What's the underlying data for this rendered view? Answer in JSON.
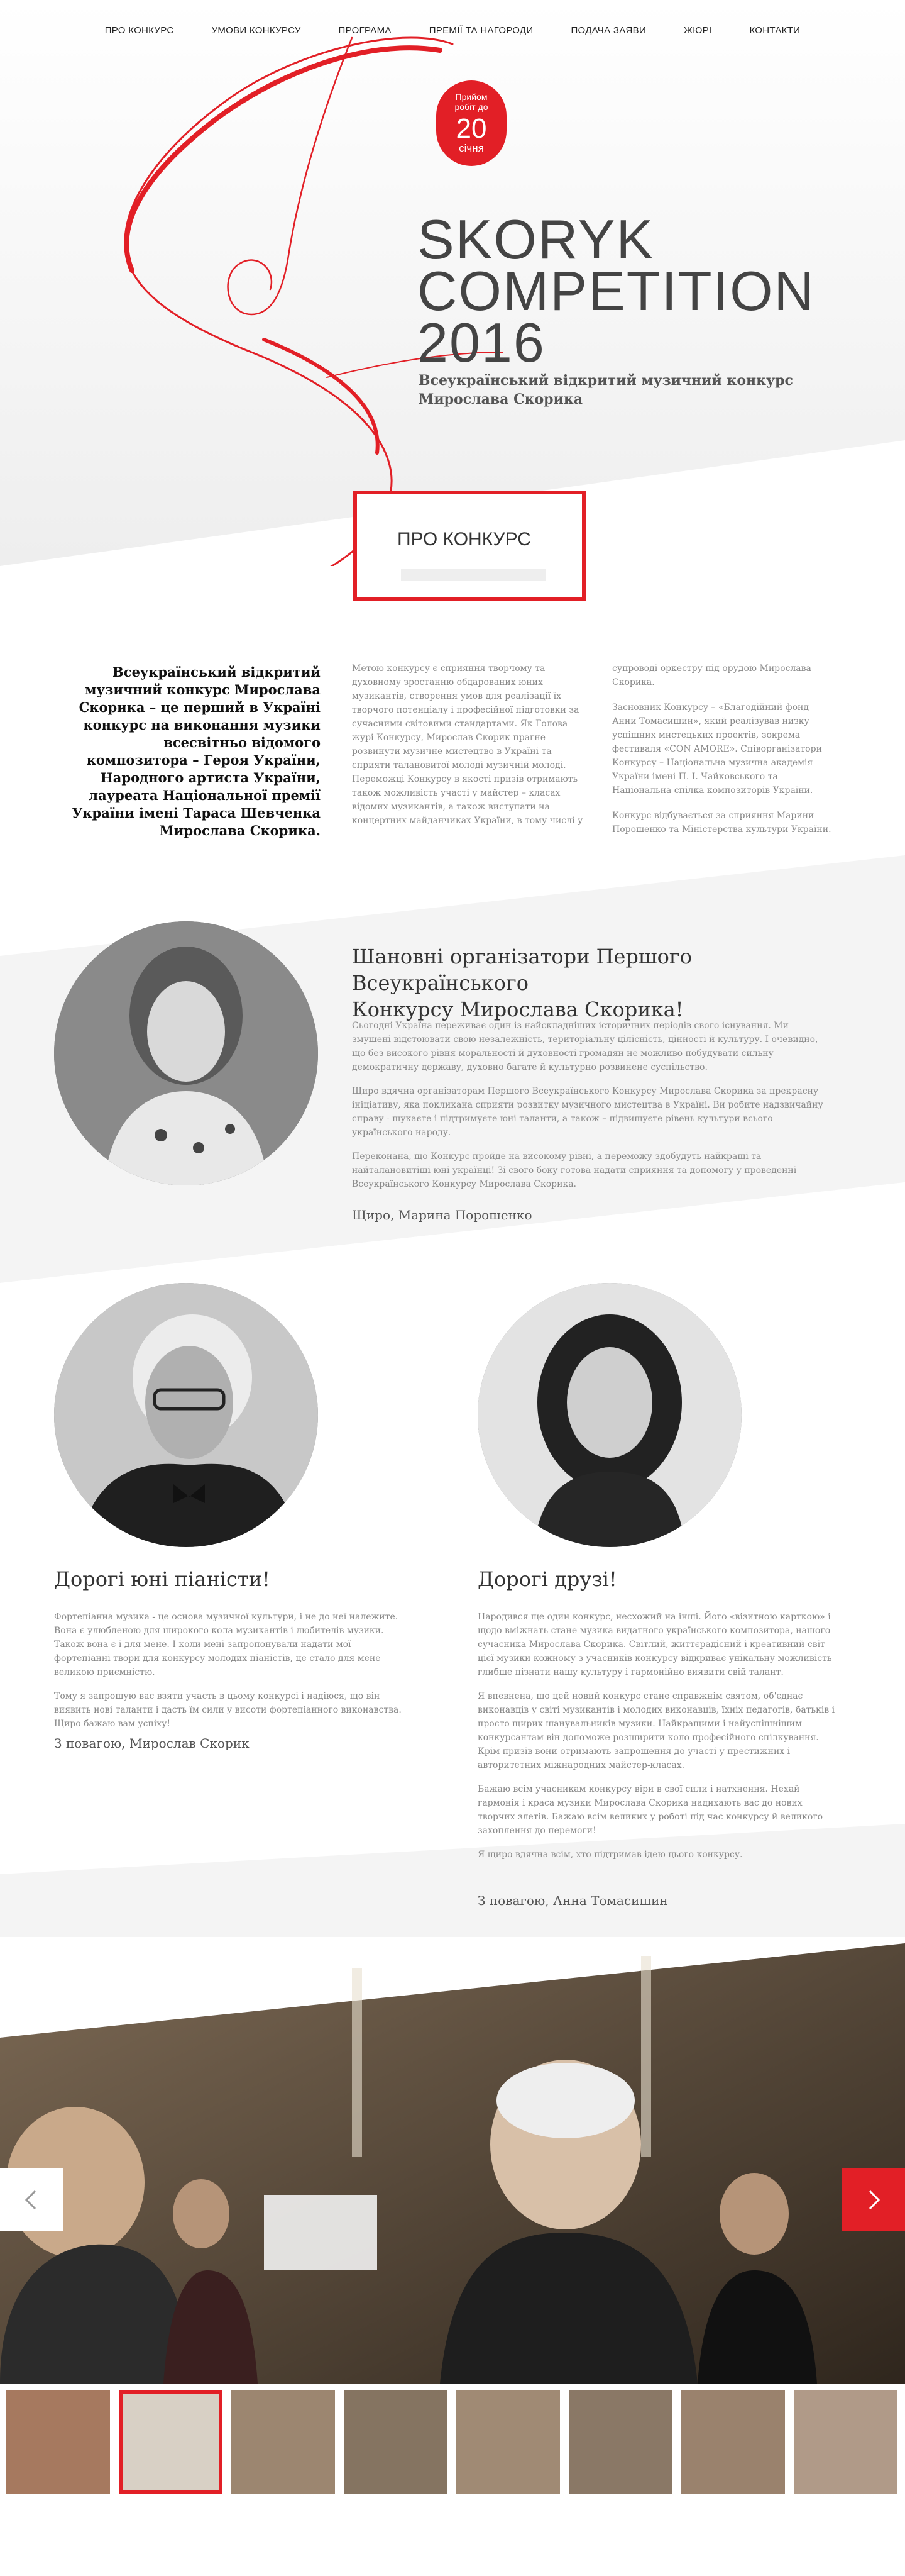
{
  "nav": [
    "ПРО КОНКУРС",
    "УМОВИ КОНКУРСУ",
    "ПРОГРАМА",
    "ПРЕМІЇ ТА НАГОРОДИ",
    "ПОДАЧА ЗАЯВИ",
    "ЖЮРІ",
    "КОНТАКТИ"
  ],
  "badge": {
    "line1": "Прийом",
    "line2": "робіт до",
    "num": "20",
    "month": "січня"
  },
  "hero": {
    "title_1": "SKORYK",
    "title_2": "COMPETITION",
    "title_3": "2016",
    "subtitle_1": "Всеукраїнський відкритий музичний конкурс",
    "subtitle_2": "Мирослава Скорика"
  },
  "about": {
    "title": "ПРО КОНКУРС"
  },
  "intro": {
    "left": "Всеукраїнський відкритий музичний конкурс Мирослава Скорика – це перший в Україні конкурс на виконання музики всесвітньо відомого композитора – Героя України, Народного артиста України, лауреата Національної премії України імені Тараса Шевченка Мирослава Скорика.",
    "col2": "Метою конкурсу є сприяння творчому та духовному зростанню обдарованих юних музикантів, створення умов для реалізації їх творчого потенціалу і професійної підготовки за сучасними світовими стандартами. Як Голова журі Конкурсу, Мирослав Скорик прагне розвинути музичне мистецтво в Україні та сприяти талановитої молоді музичній молоді. Переможці Конкурсу в якості призів отримають також можливість участі у майстер – класах відомих музикантів, а також виступати на концертних майданчиках України, в тому числі у",
    "col3a": "супроводі оркестру під орудою Мирослава Скорика.",
    "col3b": "Засновник Конкурсу – «Благодійний фонд Анни Томасишин», який реалізував низку успішних мистецьких проектів, зокрема фестиваля «CON AMORE». Співорганізатори Конкурсу – Національна музична академія України імені П. І. Чайковського та Національна спілка композиторів України.",
    "col3c": "Конкурс відбувається за сприяння Марини Порошенко та Міністерства культури України."
  },
  "letter1": {
    "title_1": "Шановні організатори Першого Всеукраїнського",
    "title_2": "Конкурсу Мирослава Скорика!",
    "p1": "Сьогодні Україна переживає один із найскладніших історичних періодів свого існування. Ми змушені відстоювати свою незалежність, територіальну цілісність, цінності й культуру. І очевидно, що без високого рівня моральності й духовності громадян не можливо побудувати сильну демократичну державу, духовно багате й культурно розвинене суспільство.",
    "p2": "Щиро вдячна організаторам Першого Всеукраїнського Конкурсу Мирослава Скорика за прекрасну ініціативу, яка покликана сприяти розвитку музичного мистецтва в Україні. Ви робите надзвичайну справу - шукаєте і підтримуєте юні таланти, а також – підвищуєте рівень культури всього українського народу.",
    "p3": "Переконана, що Конкурс пройде на високому рівні, а переможу здобудуть найкращі та найталановитіші юні українці! Зі свого боку готова надати сприяння та допомогу у проведенні Всеукраїнського Конкурсу Мирослава Скорика.",
    "sign": "Щиро, Марина Порошенко"
  },
  "letter2": {
    "title": "Дорогі юні піаністи!",
    "p1": "Фортепіанна музика - це основа музичної культури, і не до неї належите. Вона є улюбленою для широкого кола музикантів і любителів музики. Також вона є і для мене. І коли мені запропонували надати мої фортепіанні твори для конкурсу молодих піаністів, це стало для мене великою приємністю.",
    "p2": "Тому я запрошую вас взяти участь в цьому конкурсі і надіюся, що він виявить нові таланти і дасть їм сили у висоти фортепіанного виконавства. Щиро бажаю вам успіху!",
    "sign": "З повагою, Мирослав Скорик"
  },
  "letter3": {
    "title": "Дорогі друзі!",
    "p1": "Народився ще один конкурс, несхожий на інші. Його «візитною карткою» і щодо вміжнать стане музика видатного українського композитора, нашого сучасника Мирослава Скорика. Світлий, життєрадісний і креативний світ цієї музики кожному з учасників конкурсу відкриває унікальну можливість глибше пізнати нашу культуру і гармонійно виявити свій талант.",
    "p2": "Я впевнена, що цей новий конкурс стане справжнім святом, об'єднає виконавців у світі музикантів і молодих виконавців, їхніх педагогів, батьків і просто щирих шанувальників музики. Найкращими і найуспішнішим конкурсантам він допоможе розширити коло професійного спілкування. Крім призів вони отримають запрошення до участі у престижних і авторитетних міжнародних майстер-класах.",
    "p3": "Бажаю всім учасникам конкурсу віри в свої сили і натхнення. Нехай гармонія і краса музики Мирослава Скорика надихають вас до нових творчих злетів. Бажаю всім великих у роботі під час конкурсу й великого захоплення до перемоги!",
    "p4": "Я щиро вдячна всім, хто підтримав ідею цього конкурсу.",
    "sign": "З повагою, Анна Томасишин"
  },
  "colors": {
    "accent": "#e21f26",
    "text": "#333333",
    "muted": "#888888"
  },
  "icons": {
    "prev": "chevron-left-icon",
    "next": "chevron-right-icon"
  }
}
